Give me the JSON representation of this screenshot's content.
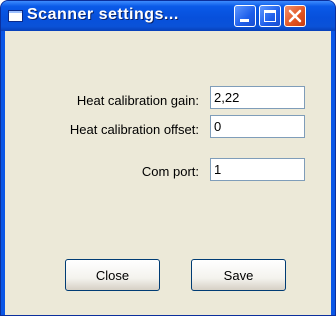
{
  "window": {
    "title": "Scanner settings..."
  },
  "form": {
    "fields": [
      {
        "label": "Heat calibration gain:",
        "value": "2,22"
      },
      {
        "label": "Heat calibration offset:",
        "value": "0"
      },
      {
        "label": "Com port:",
        "value": "1"
      }
    ]
  },
  "buttons": {
    "close_label": "Close",
    "save_label": "Save"
  },
  "icons": {
    "window": "window-icon",
    "minimize": "minimize-icon",
    "maximize": "maximize-icon",
    "close": "close-icon"
  }
}
